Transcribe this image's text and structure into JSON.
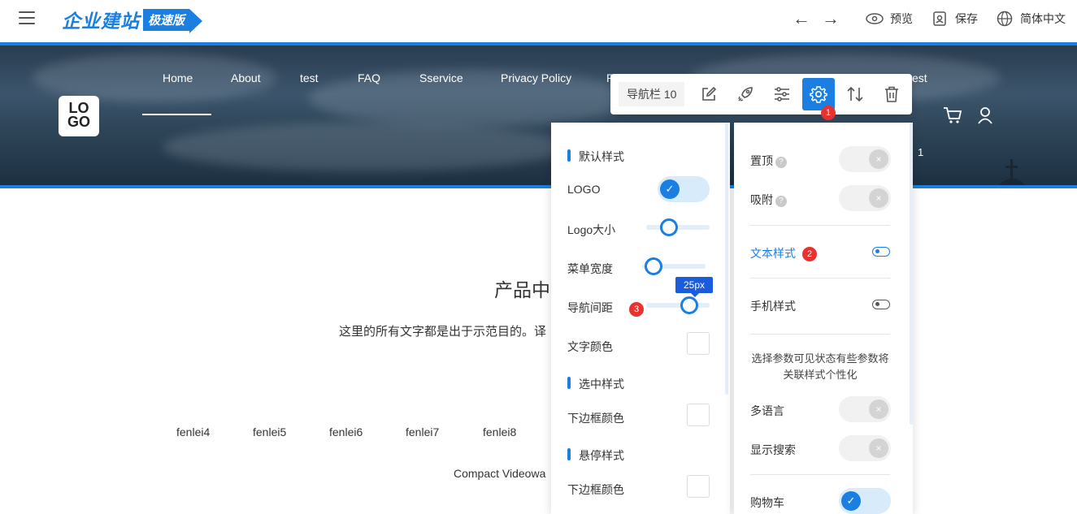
{
  "topbar": {
    "brand_main": "企业建站",
    "brand_tag": "极速版",
    "preview": "预览",
    "save": "保存",
    "language": "简体中文"
  },
  "nav": {
    "items": [
      "Home",
      "About",
      "test",
      "FAQ",
      "Sservice",
      "Privacy Policy",
      "P",
      "est"
    ],
    "extra_number": "1"
  },
  "logo": {
    "line1": "LO",
    "line2": "GO"
  },
  "toolbar": {
    "label": "导航栏 10",
    "badge": "1"
  },
  "content": {
    "title": "产品中",
    "text": "这里的所有文字都是出于示范目的。译",
    "categories": [
      "fenlei4",
      "fenlei5",
      "fenlei6",
      "fenlei7",
      "fenlei8"
    ],
    "compact": "Compact Videowa"
  },
  "style_panel": {
    "default_style": "默认样式",
    "logo": "LOGO",
    "logo_size": "Logo大小",
    "menu_width": "菜单宽度",
    "nav_spacing": "导航间距",
    "nav_spacing_value": "25px",
    "nav_spacing_badge": "3",
    "text_color": "文字颜色",
    "selected_style": "选中样式",
    "bottom_border_color": "下边框颜色",
    "hover_style": "悬停样式",
    "hover_bottom_border_color": "下边框颜色",
    "logo_size_level": 0.3,
    "menu_width_level": 0.05,
    "nav_spacing_level": 0.75
  },
  "settings_panel": {
    "pin_top": "置顶",
    "attach": "吸附",
    "help_mark": "?",
    "text_style": "文本样式",
    "text_style_badge": "2",
    "mobile_style": "手机样式",
    "note": "选择参数可见状态有些参数将关联样式个性化",
    "multi_language": "多语言",
    "show_search": "显示搜索",
    "cart": "购物车"
  },
  "icons": {
    "check": "✓",
    "off": "×"
  }
}
